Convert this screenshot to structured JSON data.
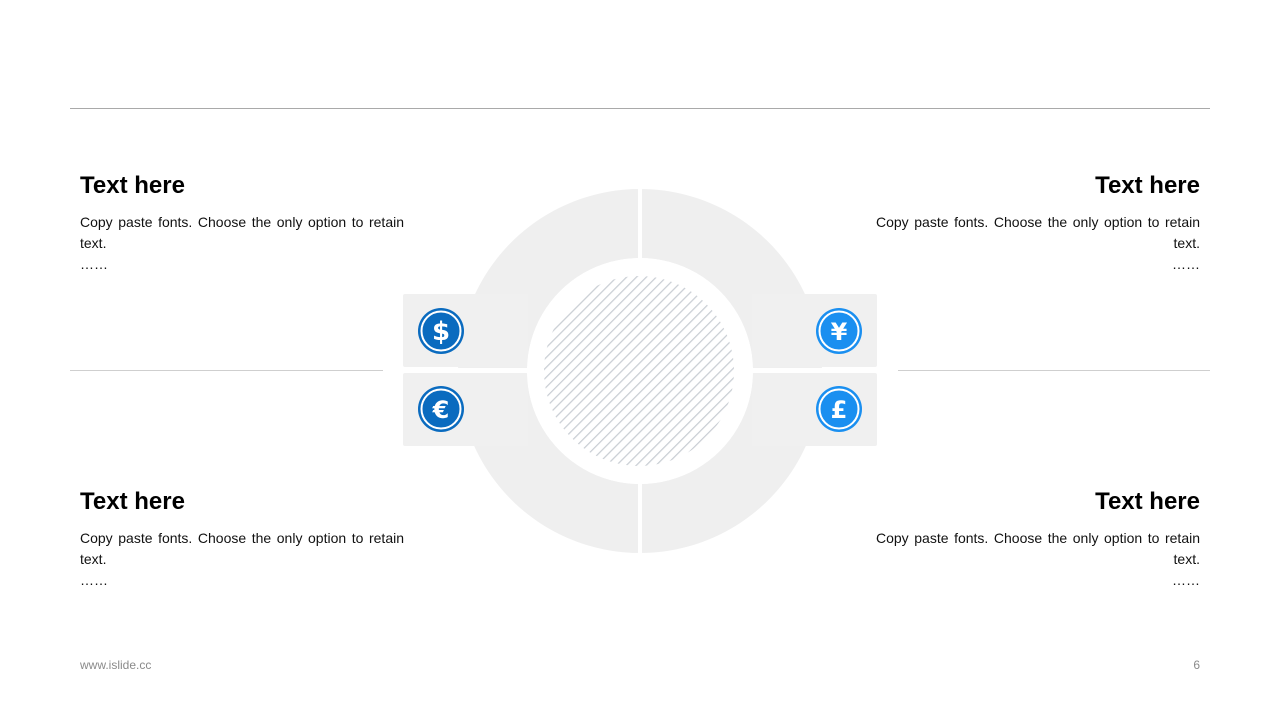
{
  "blocks": [
    {
      "title": "Text here",
      "body": "Copy paste fonts. Choose the only option to retain text.",
      "ellipsis": "……"
    },
    {
      "title": "Text here",
      "body": "Copy paste fonts. Choose the only option to retain text.",
      "ellipsis": "……"
    },
    {
      "title": "Text here",
      "body": "Copy paste fonts. Choose the only option to retain text.",
      "ellipsis": "……"
    },
    {
      "title": "Text here",
      "body": "Copy paste fonts. Choose the only option to retain text.",
      "ellipsis": "……"
    }
  ],
  "icons": {
    "top_left": {
      "symbol": "$",
      "name": "dollar-icon",
      "color": "#0a6bbf"
    },
    "bottom_left": {
      "symbol": "€",
      "name": "euro-icon",
      "color": "#0a6bbf"
    },
    "top_right": {
      "symbol": "¥",
      "name": "yen-icon",
      "color": "#1a8ff0"
    },
    "bottom_right": {
      "symbol": "£",
      "name": "pound-icon",
      "color": "#1a8ff0"
    }
  },
  "colors": {
    "ring": "#efefef",
    "tab": "#f0f0f0",
    "hatch": "#c9ced4"
  },
  "footer": {
    "url": "www.islide.cc",
    "page": "6"
  }
}
